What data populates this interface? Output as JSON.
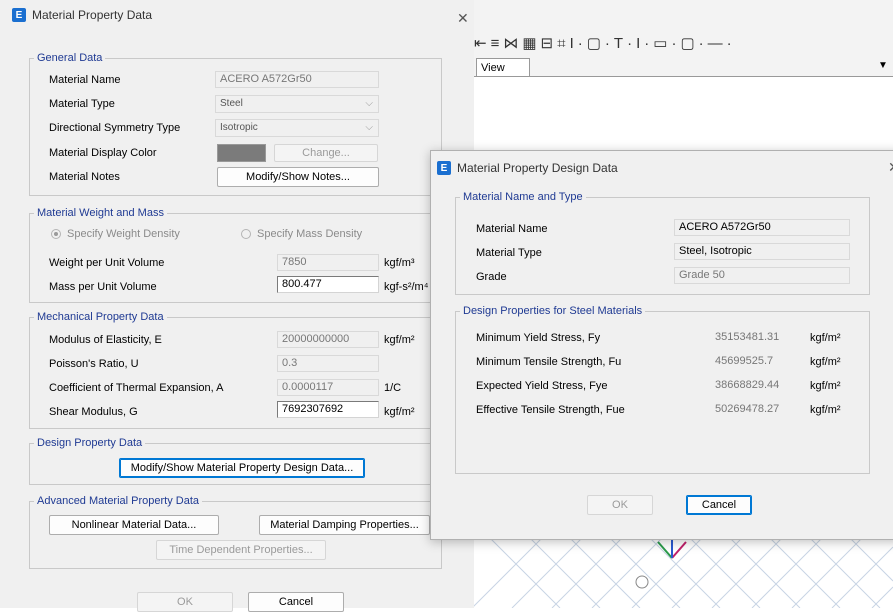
{
  "main_dialog": {
    "title": "Material Property Data",
    "general": {
      "legend": "General Data",
      "name_label": "Material Name",
      "name_value": "ACERO A572Gr50",
      "type_label": "Material Type",
      "type_value": "Steel",
      "symmetry_label": "Directional Symmetry Type",
      "symmetry_value": "Isotropic",
      "color_label": "Material Display Color",
      "color_swatch": "#7b7b7b",
      "change_label": "Change...",
      "notes_label": "Material Notes",
      "notes_button": "Modify/Show Notes..."
    },
    "weight": {
      "legend": "Material Weight and Mass",
      "radio_weight": "Specify Weight Density",
      "radio_mass": "Specify Mass Density",
      "weight_label": "Weight per Unit Volume",
      "weight_value": "7850",
      "weight_unit": "kgf/m³",
      "mass_label": "Mass per Unit Volume",
      "mass_value": "800.477",
      "mass_unit": "kgf-s²/m⁴"
    },
    "mechanical": {
      "legend": "Mechanical Property Data",
      "e_label": "Modulus of Elasticity,  E",
      "e_value": "20000000000",
      "e_unit": "kgf/m²",
      "u_label": "Poisson's Ratio,  U",
      "u_value": "0.3",
      "a_label": "Coefficient of Thermal Expansion,  A",
      "a_value": "0.0000117",
      "a_unit": "1/C",
      "g_label": "Shear Modulus,  G",
      "g_value": "7692307692",
      "g_unit": "kgf/m²"
    },
    "design": {
      "legend": "Design Property Data",
      "button": "Modify/Show Material Property Design Data..."
    },
    "advanced": {
      "legend": "Advanced Material Property Data",
      "nonlinear": "Nonlinear Material Data...",
      "damping": "Material Damping Properties...",
      "time": "Time Dependent Properties..."
    },
    "ok": "OK",
    "cancel": "Cancel"
  },
  "design_dialog": {
    "title": "Material Property Design Data",
    "name_type": {
      "legend": "Material Name and Type",
      "name_label": "Material Name",
      "name_value": "ACERO A572Gr50",
      "type_label": "Material Type",
      "type_value": "Steel, Isotropic",
      "grade_label": "Grade",
      "grade_value": "Grade 50"
    },
    "steel": {
      "legend": "Design Properties for Steel Materials",
      "fy_label": "Minimum Yield Stress, Fy",
      "fy_value": "35153481.31",
      "fu_label": "Minimum Tensile Strength, Fu",
      "fu_value": "45699525.7",
      "fye_label": "Expected Yield Stress, Fye",
      "fye_value": "38668829.44",
      "fue_label": "Effective Tensile Strength, Fue",
      "fue_value": "50269478.27",
      "unit": "kgf/m²"
    },
    "ok": "OK",
    "cancel": "Cancel"
  },
  "background_app": {
    "view_tab": "View",
    "toolbar_glyphs": [
      "⇤",
      "≡",
      "⋈",
      "▦",
      "⊟",
      "⌗",
      "I",
      "·",
      "▢",
      "·",
      "T",
      "·",
      "I",
      "·",
      "▭",
      "·",
      "▢",
      "·",
      "—",
      "·"
    ]
  },
  "colors": {
    "accent": "#0078d4",
    "legend_text": "#1f3a93",
    "app_icon": "#1a6fd0"
  }
}
